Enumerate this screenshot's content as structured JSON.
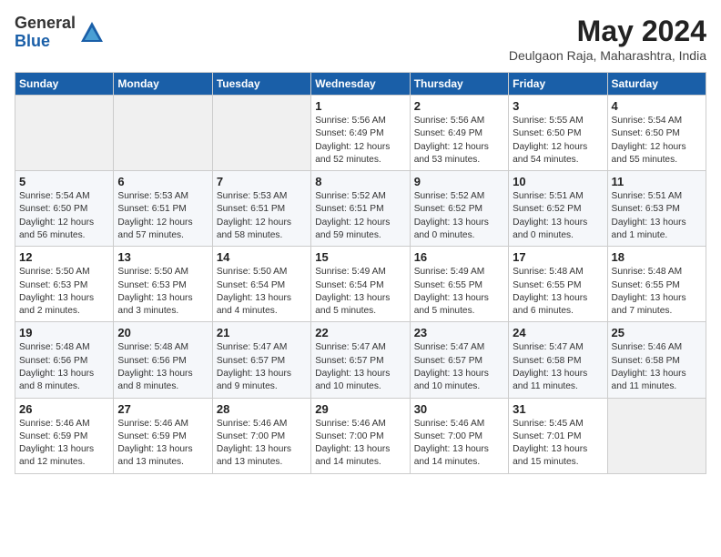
{
  "logo": {
    "general": "General",
    "blue": "Blue"
  },
  "title": "May 2024",
  "location": "Deulgaon Raja, Maharashtra, India",
  "days_of_week": [
    "Sunday",
    "Monday",
    "Tuesday",
    "Wednesday",
    "Thursday",
    "Friday",
    "Saturday"
  ],
  "weeks": [
    [
      {
        "day": "",
        "info": ""
      },
      {
        "day": "",
        "info": ""
      },
      {
        "day": "",
        "info": ""
      },
      {
        "day": "1",
        "info": "Sunrise: 5:56 AM\nSunset: 6:49 PM\nDaylight: 12 hours\nand 52 minutes."
      },
      {
        "day": "2",
        "info": "Sunrise: 5:56 AM\nSunset: 6:49 PM\nDaylight: 12 hours\nand 53 minutes."
      },
      {
        "day": "3",
        "info": "Sunrise: 5:55 AM\nSunset: 6:50 PM\nDaylight: 12 hours\nand 54 minutes."
      },
      {
        "day": "4",
        "info": "Sunrise: 5:54 AM\nSunset: 6:50 PM\nDaylight: 12 hours\nand 55 minutes."
      }
    ],
    [
      {
        "day": "5",
        "info": "Sunrise: 5:54 AM\nSunset: 6:50 PM\nDaylight: 12 hours\nand 56 minutes."
      },
      {
        "day": "6",
        "info": "Sunrise: 5:53 AM\nSunset: 6:51 PM\nDaylight: 12 hours\nand 57 minutes."
      },
      {
        "day": "7",
        "info": "Sunrise: 5:53 AM\nSunset: 6:51 PM\nDaylight: 12 hours\nand 58 minutes."
      },
      {
        "day": "8",
        "info": "Sunrise: 5:52 AM\nSunset: 6:51 PM\nDaylight: 12 hours\nand 59 minutes."
      },
      {
        "day": "9",
        "info": "Sunrise: 5:52 AM\nSunset: 6:52 PM\nDaylight: 13 hours\nand 0 minutes."
      },
      {
        "day": "10",
        "info": "Sunrise: 5:51 AM\nSunset: 6:52 PM\nDaylight: 13 hours\nand 0 minutes."
      },
      {
        "day": "11",
        "info": "Sunrise: 5:51 AM\nSunset: 6:53 PM\nDaylight: 13 hours\nand 1 minute."
      }
    ],
    [
      {
        "day": "12",
        "info": "Sunrise: 5:50 AM\nSunset: 6:53 PM\nDaylight: 13 hours\nand 2 minutes."
      },
      {
        "day": "13",
        "info": "Sunrise: 5:50 AM\nSunset: 6:53 PM\nDaylight: 13 hours\nand 3 minutes."
      },
      {
        "day": "14",
        "info": "Sunrise: 5:50 AM\nSunset: 6:54 PM\nDaylight: 13 hours\nand 4 minutes."
      },
      {
        "day": "15",
        "info": "Sunrise: 5:49 AM\nSunset: 6:54 PM\nDaylight: 13 hours\nand 5 minutes."
      },
      {
        "day": "16",
        "info": "Sunrise: 5:49 AM\nSunset: 6:55 PM\nDaylight: 13 hours\nand 5 minutes."
      },
      {
        "day": "17",
        "info": "Sunrise: 5:48 AM\nSunset: 6:55 PM\nDaylight: 13 hours\nand 6 minutes."
      },
      {
        "day": "18",
        "info": "Sunrise: 5:48 AM\nSunset: 6:55 PM\nDaylight: 13 hours\nand 7 minutes."
      }
    ],
    [
      {
        "day": "19",
        "info": "Sunrise: 5:48 AM\nSunset: 6:56 PM\nDaylight: 13 hours\nand 8 minutes."
      },
      {
        "day": "20",
        "info": "Sunrise: 5:48 AM\nSunset: 6:56 PM\nDaylight: 13 hours\nand 8 minutes."
      },
      {
        "day": "21",
        "info": "Sunrise: 5:47 AM\nSunset: 6:57 PM\nDaylight: 13 hours\nand 9 minutes."
      },
      {
        "day": "22",
        "info": "Sunrise: 5:47 AM\nSunset: 6:57 PM\nDaylight: 13 hours\nand 10 minutes."
      },
      {
        "day": "23",
        "info": "Sunrise: 5:47 AM\nSunset: 6:57 PM\nDaylight: 13 hours\nand 10 minutes."
      },
      {
        "day": "24",
        "info": "Sunrise: 5:47 AM\nSunset: 6:58 PM\nDaylight: 13 hours\nand 11 minutes."
      },
      {
        "day": "25",
        "info": "Sunrise: 5:46 AM\nSunset: 6:58 PM\nDaylight: 13 hours\nand 11 minutes."
      }
    ],
    [
      {
        "day": "26",
        "info": "Sunrise: 5:46 AM\nSunset: 6:59 PM\nDaylight: 13 hours\nand 12 minutes."
      },
      {
        "day": "27",
        "info": "Sunrise: 5:46 AM\nSunset: 6:59 PM\nDaylight: 13 hours\nand 13 minutes."
      },
      {
        "day": "28",
        "info": "Sunrise: 5:46 AM\nSunset: 7:00 PM\nDaylight: 13 hours\nand 13 minutes."
      },
      {
        "day": "29",
        "info": "Sunrise: 5:46 AM\nSunset: 7:00 PM\nDaylight: 13 hours\nand 14 minutes."
      },
      {
        "day": "30",
        "info": "Sunrise: 5:46 AM\nSunset: 7:00 PM\nDaylight: 13 hours\nand 14 minutes."
      },
      {
        "day": "31",
        "info": "Sunrise: 5:45 AM\nSunset: 7:01 PM\nDaylight: 13 hours\nand 15 minutes."
      },
      {
        "day": "",
        "info": ""
      }
    ]
  ]
}
